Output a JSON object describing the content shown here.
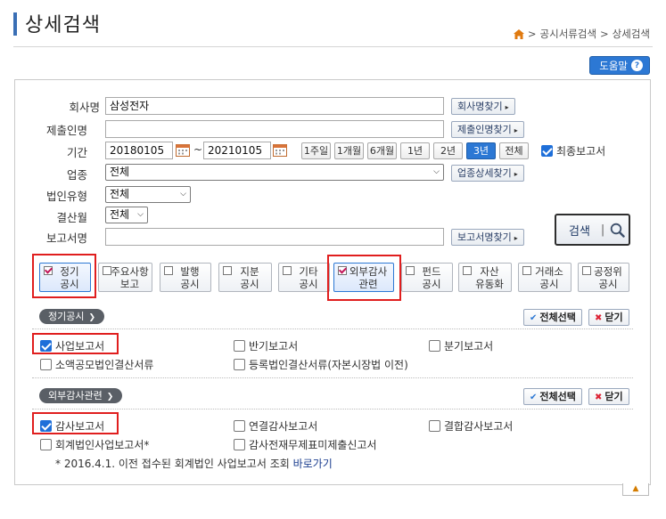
{
  "page": {
    "title": "상세검색"
  },
  "breadcrumb": {
    "item1": "공시서류검색",
    "sep": ">",
    "item2": "상세검색"
  },
  "help": {
    "label": "도움말",
    "icon": "?"
  },
  "form": {
    "company_label": "회사명",
    "company_value": "삼성전자",
    "company_btn": "회사명찾기",
    "submitter_label": "제출인명",
    "submitter_value": "",
    "submitter_btn": "제출인명찾기",
    "period_label": "기간",
    "start_date": "20180105",
    "date_sep": "~",
    "end_date": "20210105",
    "periods": [
      "1주일",
      "1개월",
      "6개월",
      "1년",
      "2년",
      "3년",
      "전체"
    ],
    "active_period": "3년",
    "final_report_label": "최종보고서",
    "industry_label": "업종",
    "industry_value": "전체",
    "industry_btn": "업종상세찾기",
    "corp_type_label": "법인유형",
    "corp_type_value": "전체",
    "fiscal_month_label": "결산월",
    "fiscal_month_value": "전체",
    "report_name_label": "보고서명",
    "report_name_value": "",
    "report_name_btn": "보고서명찾기",
    "search_btn": "검색",
    "search_sep": "|"
  },
  "categories": [
    {
      "line1": "정기",
      "line2": "공시",
      "checked": true
    },
    {
      "line1": "주요사항",
      "line2": "보고",
      "checked": false
    },
    {
      "line1": "발행",
      "line2": "공시",
      "checked": false
    },
    {
      "line1": "지분",
      "line2": "공시",
      "checked": false
    },
    {
      "line1": "기타",
      "line2": "공시",
      "checked": false
    },
    {
      "line1": "외부감사",
      "line2": "관련",
      "checked": true
    },
    {
      "line1": "펀드",
      "line2": "공시",
      "checked": false
    },
    {
      "line1": "자산",
      "line2": "유동화",
      "checked": false
    },
    {
      "line1": "거래소",
      "line2": "공시",
      "checked": false
    },
    {
      "line1": "공정위",
      "line2": "공시",
      "checked": false
    }
  ],
  "sections": {
    "regular": {
      "tag": "정기공시",
      "select_all": "전체선택",
      "close": "닫기",
      "items": [
        "사업보고서",
        "반기보고서",
        "분기보고서",
        "소액공모법인결산서류",
        "등록법인결산서류(자본시장법 이전)"
      ]
    },
    "audit": {
      "tag": "외부감사관련",
      "select_all": "전체선택",
      "close": "닫기",
      "items": [
        "감사보고서",
        "연결감사보고서",
        "결합감사보고서",
        "회계법인사업보고서*",
        "감사전재무제표미제출신고서"
      ]
    }
  },
  "note": {
    "text": "* 2016.4.1. 이전 접수된 회계법인 사업보고서 조회",
    "link": "바로가기"
  },
  "top_btn": "▲",
  "colors": {
    "accent": "#2c78d4",
    "highlight": "#e01e1e",
    "title_bar": "#3a6fb5"
  }
}
